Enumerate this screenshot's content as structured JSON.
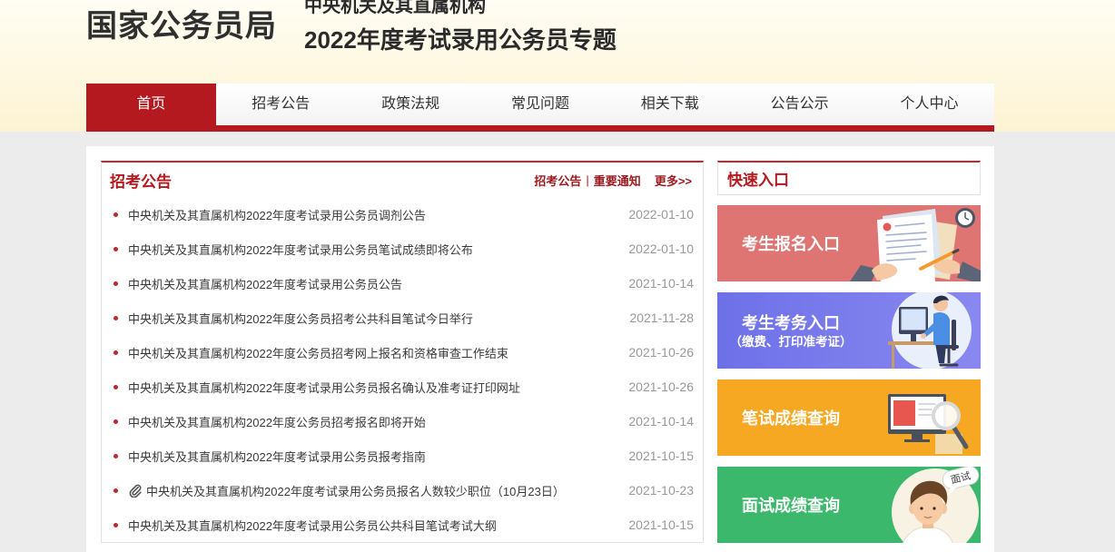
{
  "header": {
    "logo": "国家公务员局",
    "subtitle_line1": "中央机关及其直属机构",
    "subtitle_line2": "2022年度考试录用公务员专题"
  },
  "nav": {
    "items": [
      {
        "label": "首页",
        "active": true
      },
      {
        "label": "招考公告",
        "active": false
      },
      {
        "label": "政策法规",
        "active": false
      },
      {
        "label": "常见问题",
        "active": false
      },
      {
        "label": "相关下载",
        "active": false
      },
      {
        "label": "公告公示",
        "active": false
      },
      {
        "label": "个人中心",
        "active": false
      }
    ]
  },
  "announcements": {
    "title": "招考公告",
    "links": {
      "recruit": "招考公告",
      "separator": "|",
      "notice": "重要通知",
      "more": "更多>>"
    },
    "items": [
      {
        "title": "中央机关及其直属机构2022年度考试录用公务员调剂公告",
        "date": "2022-01-10"
      },
      {
        "title": "中央机关及其直属机构2022年度考试录用公务员笔试成绩即将公布",
        "date": "2022-01-10"
      },
      {
        "title": "中央机关及其直属机构2022年度考试录用公务员公告",
        "date": "2021-10-14"
      },
      {
        "title": "中央机关及其直属机构2022年度公务员招考公共科目笔试今日举行",
        "date": "2021-11-28"
      },
      {
        "title": "中央机关及其直属机构2022年度公务员招考网上报名和资格审查工作结束",
        "date": "2021-10-26"
      },
      {
        "title": "中央机关及其直属机构2022年度考试录用公务员报名确认及准考证打印网址",
        "date": "2021-10-26"
      },
      {
        "title": "中央机关及其直属机构2022年度公务员招考报名即将开始",
        "date": "2021-10-14"
      },
      {
        "title": "中央机关及其直属机构2022年度考试录用公务员报考指南",
        "date": "2021-10-15"
      },
      {
        "title": "中央机关及其直属机构2022年度考试录用公务员报名人数较少职位（10月23日）",
        "date": "2021-10-23",
        "icon": "paperclip-icon"
      },
      {
        "title": "中央机关及其直属机构2022年度考试录用公务员公共科目笔试考试大纲",
        "date": "2021-10-15"
      }
    ]
  },
  "quick_entry": {
    "title": "快速入口",
    "cards": [
      {
        "label": "考生报名入口",
        "color": "#df7573",
        "icon": "registration-illustration"
      },
      {
        "label": "考生考务入口",
        "sublabel": "（缴费、打印准考证）",
        "color": "#6d71e8",
        "icon": "exam-affairs-illustration"
      },
      {
        "label": "笔试成绩查询",
        "color": "#f7a822",
        "icon": "written-score-illustration"
      },
      {
        "label": "面试成绩查询",
        "color": "#3bb86b",
        "icon": "interview-score-illustration",
        "badge": "面试"
      }
    ]
  },
  "colors": {
    "accent": "#b3191f",
    "header_bg": "#fdf6dc",
    "page_bg": "#ececec",
    "date_text": "#999999"
  }
}
